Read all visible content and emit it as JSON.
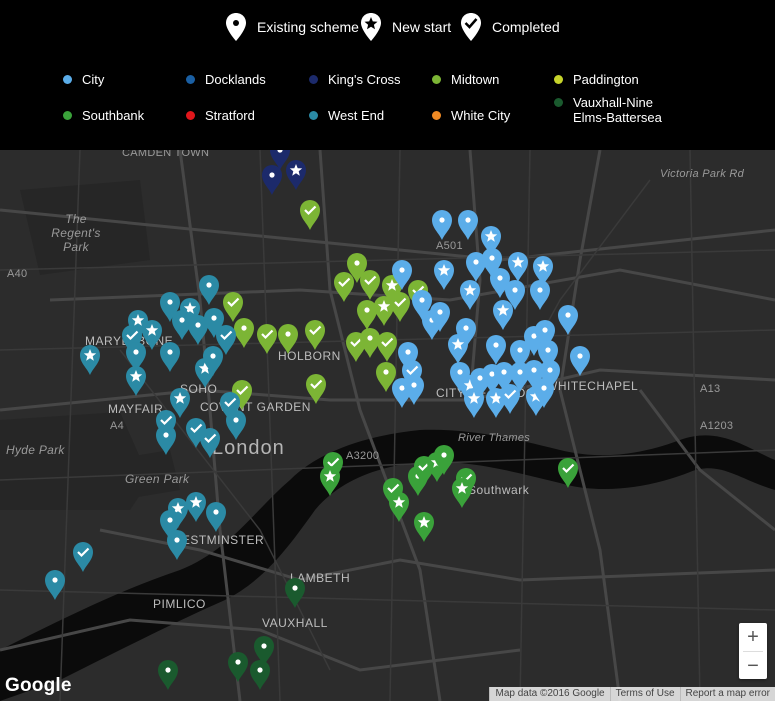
{
  "legend": {
    "types": [
      {
        "key": "existing",
        "label": "Existing scheme",
        "icon": "pin-dot-icon"
      },
      {
        "key": "new",
        "label": "New start",
        "icon": "pin-star-icon"
      },
      {
        "key": "completed",
        "label": "Completed",
        "icon": "pin-check-icon"
      }
    ],
    "areas": [
      {
        "key": "city",
        "label": "City",
        "color": "#5bade9"
      },
      {
        "key": "docklands",
        "label": "Docklands",
        "color": "#1a5fa3"
      },
      {
        "key": "kings",
        "label": "King's Cross",
        "color": "#1c2a6b"
      },
      {
        "key": "midtown",
        "label": "Midtown",
        "color": "#7cb535"
      },
      {
        "key": "paddington",
        "label": "Paddington",
        "color": "#c6d42b"
      },
      {
        "key": "southbank",
        "label": "Southbank",
        "color": "#3aa23a"
      },
      {
        "key": "stratford",
        "label": "Stratford",
        "color": "#e0161b"
      },
      {
        "key": "westend",
        "label": "West End",
        "color": "#2b8aa5"
      },
      {
        "key": "whitecity",
        "label": "White City",
        "color": "#f08a24"
      },
      {
        "key": "vauxhall",
        "label": "Vauxhall-Nine Elms-Battersea",
        "color": "#1a5a2e"
      }
    ]
  },
  "map": {
    "labels": {
      "camden": "CAMDEN TOWN",
      "regents": "The Regent's Park",
      "marylebone": "MARYLEBONE",
      "holborn": "HOLBORN",
      "soho": "SOHO",
      "mayfair": "MAYFAIR",
      "covent": "COVENT GARDEN",
      "london": "London",
      "city": "CITY OF LONDON",
      "whitechapel": "WHITECHAPEL",
      "hydepark": "Hyde Park",
      "greenpark": "Green Park",
      "westminster": "WESTMINSTER",
      "lambeth": "LAMBETH",
      "pimlico": "PIMLICO",
      "vauxhall": "VAUXHALL",
      "southwark": "Southwark",
      "thames": "River Thames",
      "victoriapark": "Victoria Park Rd",
      "a501": "A501",
      "a40": "A40",
      "a4": "A4",
      "a3200": "A3200",
      "a13": "A13",
      "a1203": "A1203"
    },
    "zoom_in": "+",
    "zoom_out": "−",
    "google": "Google",
    "attribution": [
      "Map data ©2016 Google",
      "Terms of Use",
      "Report a map error"
    ]
  }
}
